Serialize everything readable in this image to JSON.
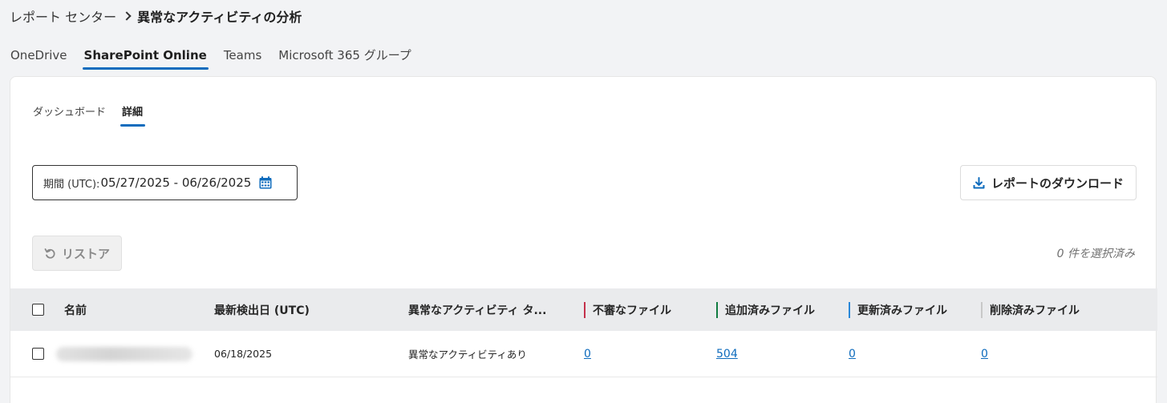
{
  "breadcrumb": {
    "parent": "レポート センター",
    "current": "異常なアクティビティの分析"
  },
  "top_tabs": [
    {
      "label": "OneDrive",
      "active": false
    },
    {
      "label": "SharePoint Online",
      "active": true
    },
    {
      "label": "Teams",
      "active": false
    },
    {
      "label": "Microsoft 365 グループ",
      "active": false
    }
  ],
  "sub_tabs": [
    {
      "label": "ダッシュボード",
      "active": false
    },
    {
      "label": "詳細",
      "active": true
    }
  ],
  "date_range": {
    "label": "期間 (UTC):",
    "value": "05/27/2025 - 06/26/2025",
    "icon": "calendar-icon"
  },
  "download_button": {
    "label": "レポートのダウンロード",
    "icon": "download-icon"
  },
  "restore_button": {
    "label": "リストア",
    "icon": "restore-icon",
    "disabled": true
  },
  "selected_count": "0 件を選択済み",
  "table": {
    "columns": [
      {
        "label": "名前"
      },
      {
        "label": "最新検出日 (UTC)"
      },
      {
        "label": "異常なアクティビティ タ..."
      },
      {
        "label": "不審なファイル",
        "bar_color": "#c4314b"
      },
      {
        "label": "追加済みファイル",
        "bar_color": "#107c41"
      },
      {
        "label": "更新済みファイル",
        "bar_color": "#2b88d8"
      },
      {
        "label": "削除済みファイル",
        "bar_color": "#c8c8c8"
      }
    ],
    "rows": [
      {
        "name": "",
        "last_detected": "06/18/2025",
        "activity_type": "異常なアクティビティあり",
        "suspicious": "0",
        "added": "504",
        "updated": "0",
        "deleted": "0"
      }
    ]
  },
  "colors": {
    "accent": "#0f6cbd",
    "background": "#f2f3f5"
  }
}
